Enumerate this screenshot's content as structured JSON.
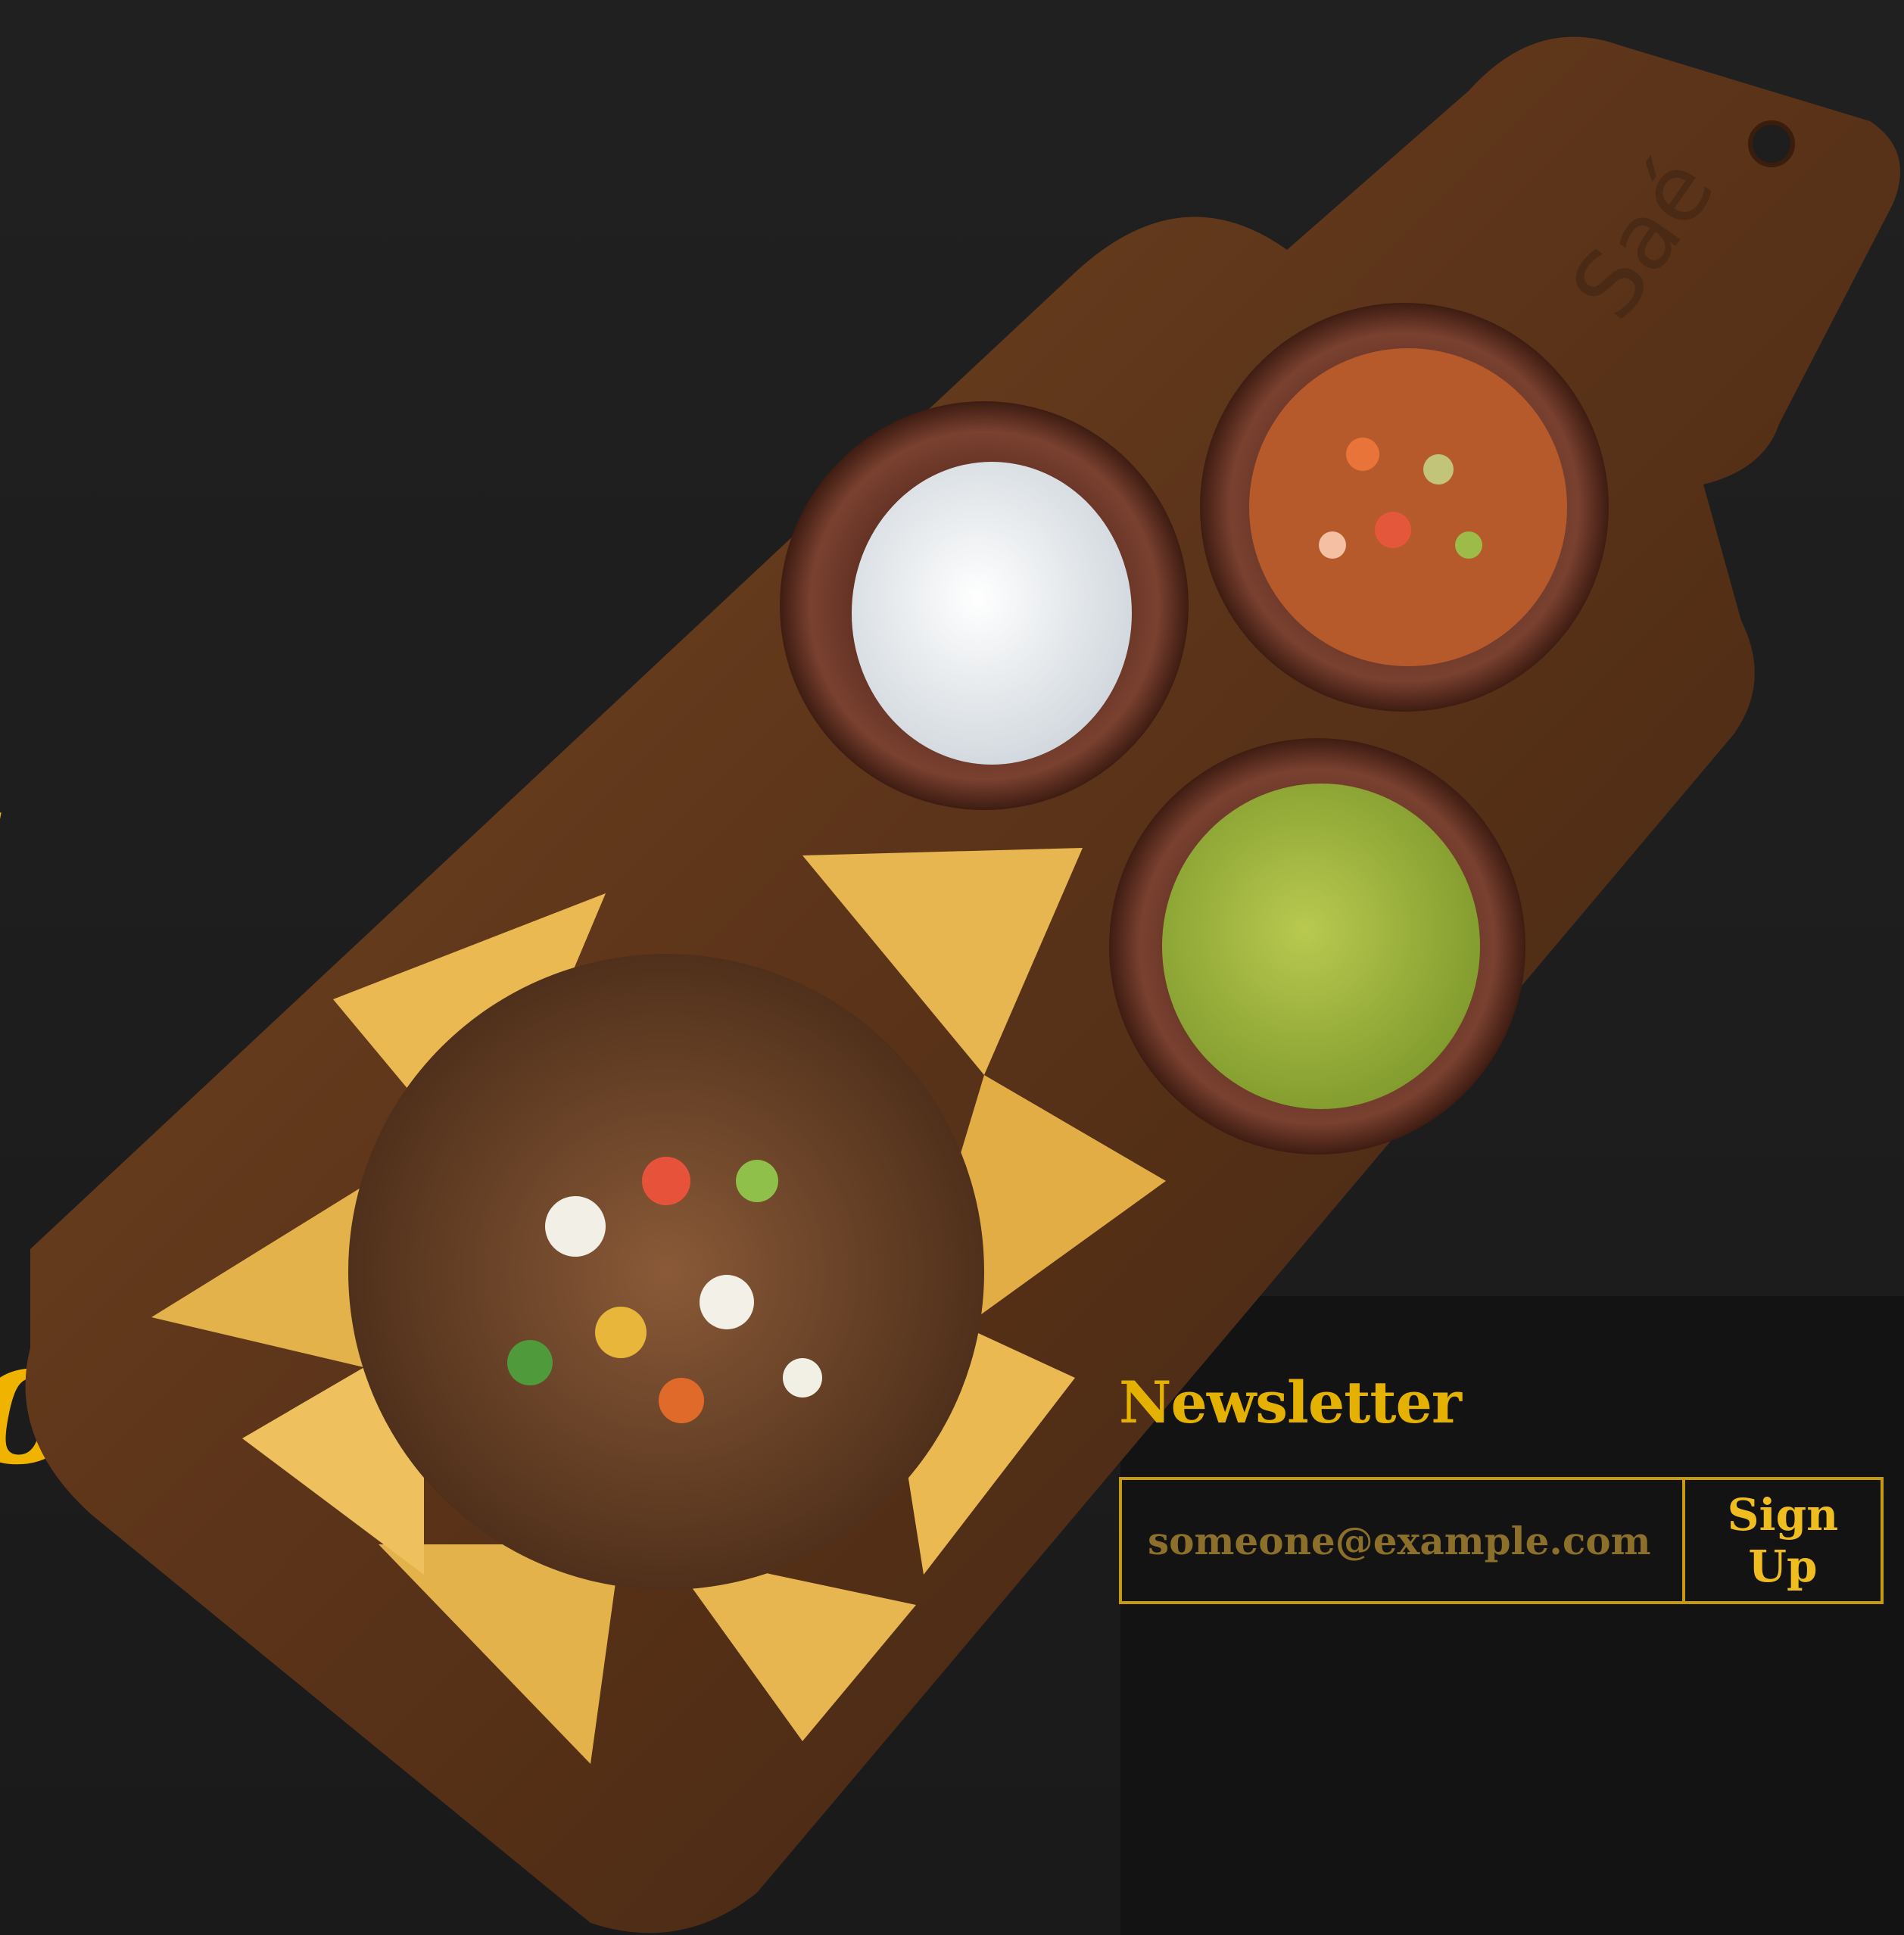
{
  "hero": {
    "title_line1": "pes",
    "title_line2": "nbox!"
  },
  "image": {
    "description_label": "nachos-board-photo",
    "board_engraving": "Saé"
  },
  "newsletter": {
    "title": "Newsletter",
    "email_placeholder": "someone@example.com",
    "email_value": "",
    "signup_label": "Sign Up"
  },
  "colors": {
    "accent": "#f0b400",
    "background": "#1e1e1e",
    "footer_band": "#131313",
    "border": "#c59a10"
  }
}
